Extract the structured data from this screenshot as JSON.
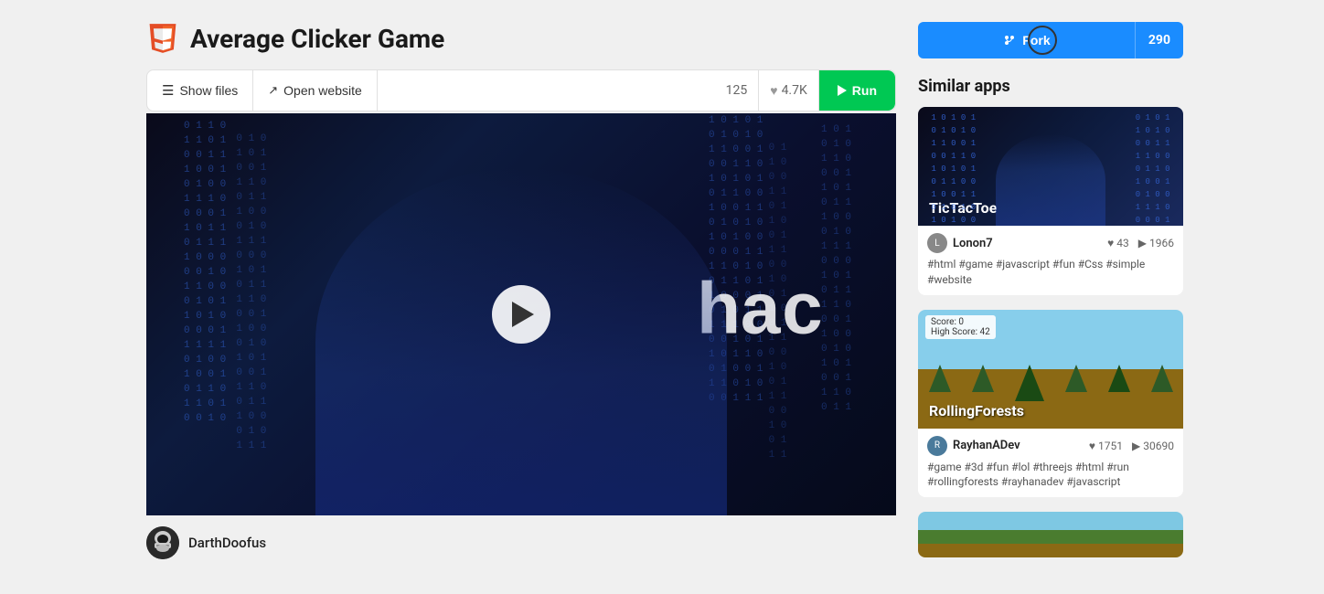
{
  "page": {
    "title": "Average Clicker Game"
  },
  "header": {
    "app_icon": "html5",
    "app_title": "Average Clicker Game"
  },
  "toolbar": {
    "show_files_label": "Show files",
    "open_website_label": "Open website",
    "likes_count": "125",
    "forks_count": "4.7K",
    "run_label": "Run"
  },
  "fork_button": {
    "fork_label": "Fork",
    "fork_count": "290"
  },
  "video": {
    "hac_text": "hac",
    "play_visible": true
  },
  "author": {
    "name": "DarthDoofus"
  },
  "sidebar": {
    "similar_apps_title": "Similar apps",
    "apps": [
      {
        "title": "TicTacToe",
        "author": "Lonon7",
        "likes": "43",
        "runs": "1966",
        "tags": "#html #game #javascript #fun #Css #simple #website",
        "thumb_type": "tictactoe"
      },
      {
        "title": "RollingForests",
        "author": "RayhanADev",
        "likes": "1751",
        "runs": "30690",
        "tags": "#game #3d #fun #lol #threejs #html #run #rollingforests #rayhanadev #javascript",
        "thumb_type": "rollingforests"
      },
      {
        "title": "",
        "author": "",
        "likes": "",
        "runs": "",
        "tags": "",
        "thumb_type": "third"
      }
    ]
  }
}
